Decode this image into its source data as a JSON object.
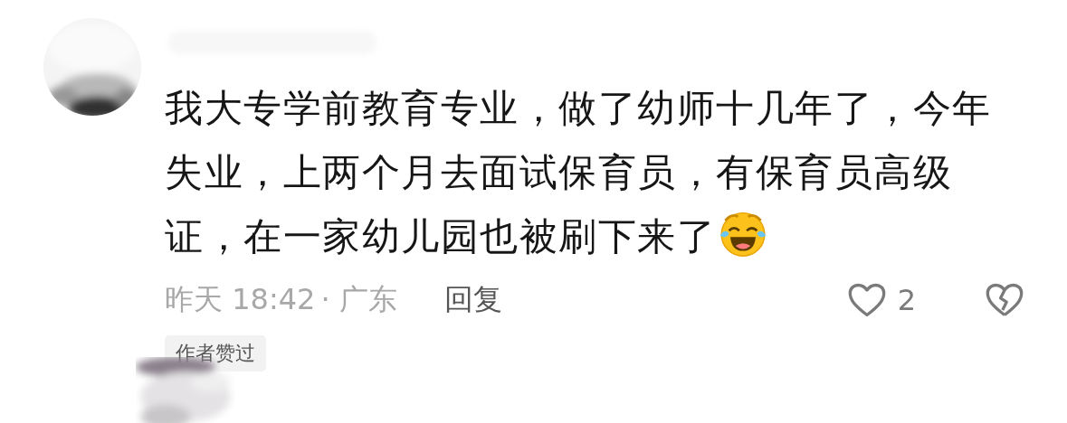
{
  "comment": {
    "text": "我大专学前教育专业，做了幼师十几年了，今年失业，上两个月去面试保育员，有保育员高级证，在一家幼儿园也被刷下来了",
    "time": "昨天 18:42",
    "location": "· 广东",
    "reply": "回复",
    "likes": "2",
    "liked": false,
    "disliked": false,
    "badge": "作者赞过"
  }
}
